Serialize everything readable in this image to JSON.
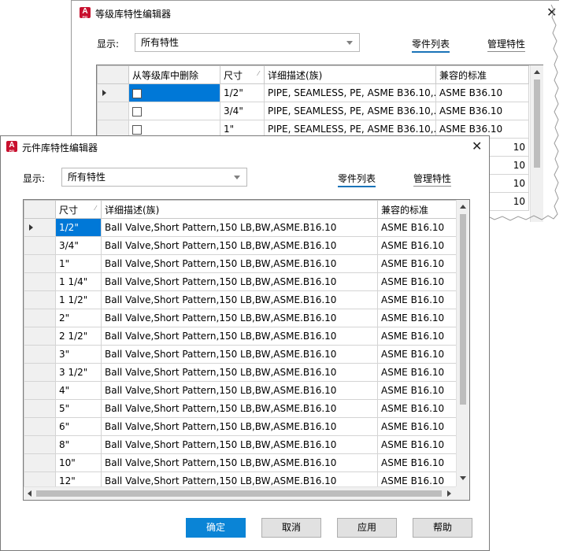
{
  "back_dialog": {
    "title": "等级库特性编辑器",
    "display_label": "显示:",
    "display_value": "所有特性",
    "tab_parts": "零件列表",
    "tab_manage": "管理特性",
    "headers": [
      "从等级库中删除",
      "尺寸",
      "详细描述(族)",
      "兼容的标准"
    ],
    "rows": [
      {
        "size": "1/2\"",
        "desc": "PIPE, SEAMLESS, PE, ASME B36.10,...",
        "std": "ASME B36.10"
      },
      {
        "size": "3/4\"",
        "desc": "PIPE, SEAMLESS, PE, ASME B36.10,...",
        "std": "ASME B36.10"
      },
      {
        "size": "1\"",
        "desc": "PIPE, SEAMLESS, PE, ASME B36.10,...",
        "std": "ASME B36.10"
      }
    ],
    "partial_std": [
      "10",
      "10",
      "10",
      "10"
    ]
  },
  "front_dialog": {
    "title": "元件库特性编辑器",
    "display_label": "显示:",
    "display_value": "所有特性",
    "tab_parts": "零件列表",
    "tab_manage": "管理特性",
    "headers": [
      "尺寸",
      "详细描述(族)",
      "兼容的标准"
    ],
    "rows": [
      {
        "size": "1/2\"",
        "desc": "Ball Valve,Short Pattern,150 LB,BW,ASME.B16.10",
        "std": "ASME B16.10"
      },
      {
        "size": "3/4\"",
        "desc": "Ball Valve,Short Pattern,150 LB,BW,ASME.B16.10",
        "std": "ASME B16.10"
      },
      {
        "size": "1\"",
        "desc": "Ball Valve,Short Pattern,150 LB,BW,ASME.B16.10",
        "std": "ASME B16.10"
      },
      {
        "size": "1 1/4\"",
        "desc": "Ball Valve,Short Pattern,150 LB,BW,ASME.B16.10",
        "std": "ASME B16.10"
      },
      {
        "size": "1 1/2\"",
        "desc": "Ball Valve,Short Pattern,150 LB,BW,ASME.B16.10",
        "std": "ASME B16.10"
      },
      {
        "size": "2\"",
        "desc": "Ball Valve,Short Pattern,150 LB,BW,ASME.B16.10",
        "std": "ASME B16.10"
      },
      {
        "size": "2 1/2\"",
        "desc": "Ball Valve,Short Pattern,150 LB,BW,ASME.B16.10",
        "std": "ASME B16.10"
      },
      {
        "size": "3\"",
        "desc": "Ball Valve,Short Pattern,150 LB,BW,ASME.B16.10",
        "std": "ASME B16.10"
      },
      {
        "size": "3 1/2\"",
        "desc": "Ball Valve,Short Pattern,150 LB,BW,ASME.B16.10",
        "std": "ASME B16.10"
      },
      {
        "size": "4\"",
        "desc": "Ball Valve,Short Pattern,150 LB,BW,ASME.B16.10",
        "std": "ASME B16.10"
      },
      {
        "size": "5\"",
        "desc": "Ball Valve,Short Pattern,150 LB,BW,ASME.B16.10",
        "std": "ASME B16.10"
      },
      {
        "size": "6\"",
        "desc": "Ball Valve,Short Pattern,150 LB,BW,ASME.B16.10",
        "std": "ASME B16.10"
      },
      {
        "size": "8\"",
        "desc": "Ball Valve,Short Pattern,150 LB,BW,ASME.B16.10",
        "std": "ASME B16.10"
      },
      {
        "size": "10\"",
        "desc": "Ball Valve,Short Pattern,150 LB,BW,ASME.B16.10",
        "std": "ASME B16.10"
      },
      {
        "size": "12\"",
        "desc": "Ball Valve,Short Pattern,150 LB,BW,ASME.B16.10",
        "std": "ASME B16.10"
      }
    ],
    "buttons": {
      "ok": "确定",
      "cancel": "取消",
      "apply": "应用",
      "help": "帮助"
    }
  },
  "colors": {
    "accent": "#0a84d6",
    "selection": "#0078d7",
    "autocad_red": "#c8102e"
  }
}
